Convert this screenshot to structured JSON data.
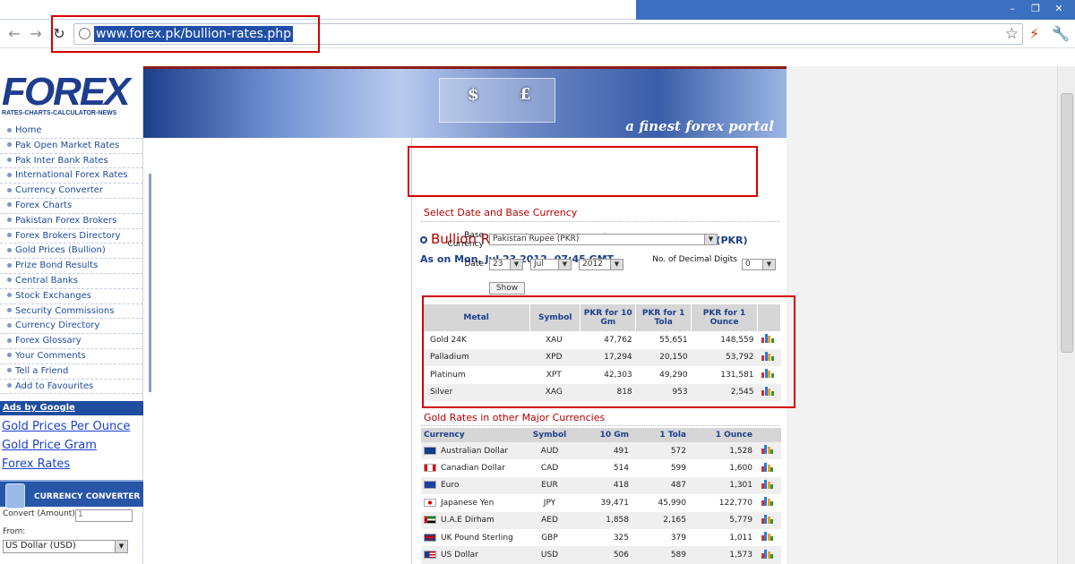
{
  "browser": {
    "url": "www.forex.pk/bullion-rates.php",
    "window_buttons": [
      "–",
      "❐",
      "✕"
    ]
  },
  "sidebar": {
    "logo_text": "FOREX",
    "logo_tagline": "RATES-CHARTS-CALCULATOR-NEWS",
    "menu": [
      "Home",
      "Pak Open Market Rates",
      "Pak Inter Bank Rates",
      "International Forex Rates",
      "Currency Converter",
      "Forex Charts",
      "Pakistan Forex Brokers",
      "Forex Brokers Directory",
      "Gold Prices (Bullion)",
      "Prize Bond Results",
      "Central Banks",
      "Stock Exchanges",
      "Security Commissions",
      "Currency Directory",
      "Forex Glossary",
      "Your Comments",
      "Tell a Friend",
      "Add to Favourites"
    ],
    "ads_header": "Ads by Google",
    "ad_links": [
      "Gold Prices Per Ounce",
      "Gold Price Gram",
      "Forex Rates"
    ],
    "converter": {
      "title": "CURRENCY CONVERTER",
      "amount_label": "Convert (Amount)",
      "amount_value": "1",
      "from_label": "From:",
      "from_value": "US Dollar (USD)"
    }
  },
  "banner": {
    "tagline": "a finest forex portal",
    "symbols": [
      "$",
      "£"
    ]
  },
  "main": {
    "heading": "Bullion Rates (Gold Prices)",
    "heading_suffix": "in Pakistan Rupee (PKR)",
    "as_on": "As on Mon, Jul 23 2012, 07:45 GMT",
    "select_title": "Select Date and Base Currency",
    "form": {
      "base_currency_label": "Base Currency",
      "base_currency_value": "Pakistan Rupee (PKR)",
      "date_label": "Date",
      "day": "23",
      "month": "Jul",
      "year": "2012",
      "decimal_label": "No. of Decimal Digits",
      "decimal_value": "0",
      "show_button": "Show"
    },
    "bullion_table": {
      "headers": [
        "Metal",
        "Symbol",
        "PKR for 10 Gm",
        "PKR for 1 Tola",
        "PKR for 1 Ounce"
      ],
      "rows": [
        {
          "metal": "Gold 24K",
          "symbol": "XAU",
          "gm10": "47,762",
          "tola": "55,651",
          "ounce": "148,559"
        },
        {
          "metal": "Palladium",
          "symbol": "XPD",
          "gm10": "17,294",
          "tola": "20,150",
          "ounce": "53,792"
        },
        {
          "metal": "Platinum",
          "symbol": "XPT",
          "gm10": "42,303",
          "tola": "49,290",
          "ounce": "131,581"
        },
        {
          "metal": "Silver",
          "symbol": "XAG",
          "gm10": "818",
          "tola": "953",
          "ounce": "2,545"
        }
      ]
    },
    "major_title": "Gold Rates in other Major Currencies",
    "currency_table": {
      "headers": [
        "Currency",
        "Symbol",
        "10 Gm",
        "1 Tola",
        "1 Ounce"
      ],
      "rows": [
        {
          "currency": "Australian Dollar",
          "symbol": "AUD",
          "gm10": "491",
          "tola": "572",
          "ounce": "1,528"
        },
        {
          "currency": "Canadian Dollar",
          "symbol": "CAD",
          "gm10": "514",
          "tola": "599",
          "ounce": "1,600"
        },
        {
          "currency": "Euro",
          "symbol": "EUR",
          "gm10": "418",
          "tola": "487",
          "ounce": "1,301"
        },
        {
          "currency": "Japanese Yen",
          "symbol": "JPY",
          "gm10": "39,471",
          "tola": "45,990",
          "ounce": "122,770"
        },
        {
          "currency": "U.A.E Dirham",
          "symbol": "AED",
          "gm10": "1,858",
          "tola": "2,165",
          "ounce": "5,779"
        },
        {
          "currency": "UK Pound Sterling",
          "symbol": "GBP",
          "gm10": "325",
          "tola": "379",
          "ounce": "1,011"
        },
        {
          "currency": "US Dollar",
          "symbol": "USD",
          "gm10": "506",
          "tola": "589",
          "ounce": "1,573"
        }
      ]
    }
  },
  "colors": {
    "highlight": "#d40000",
    "brand_blue": "#1d3f8a",
    "heading_red": "#b40000"
  }
}
